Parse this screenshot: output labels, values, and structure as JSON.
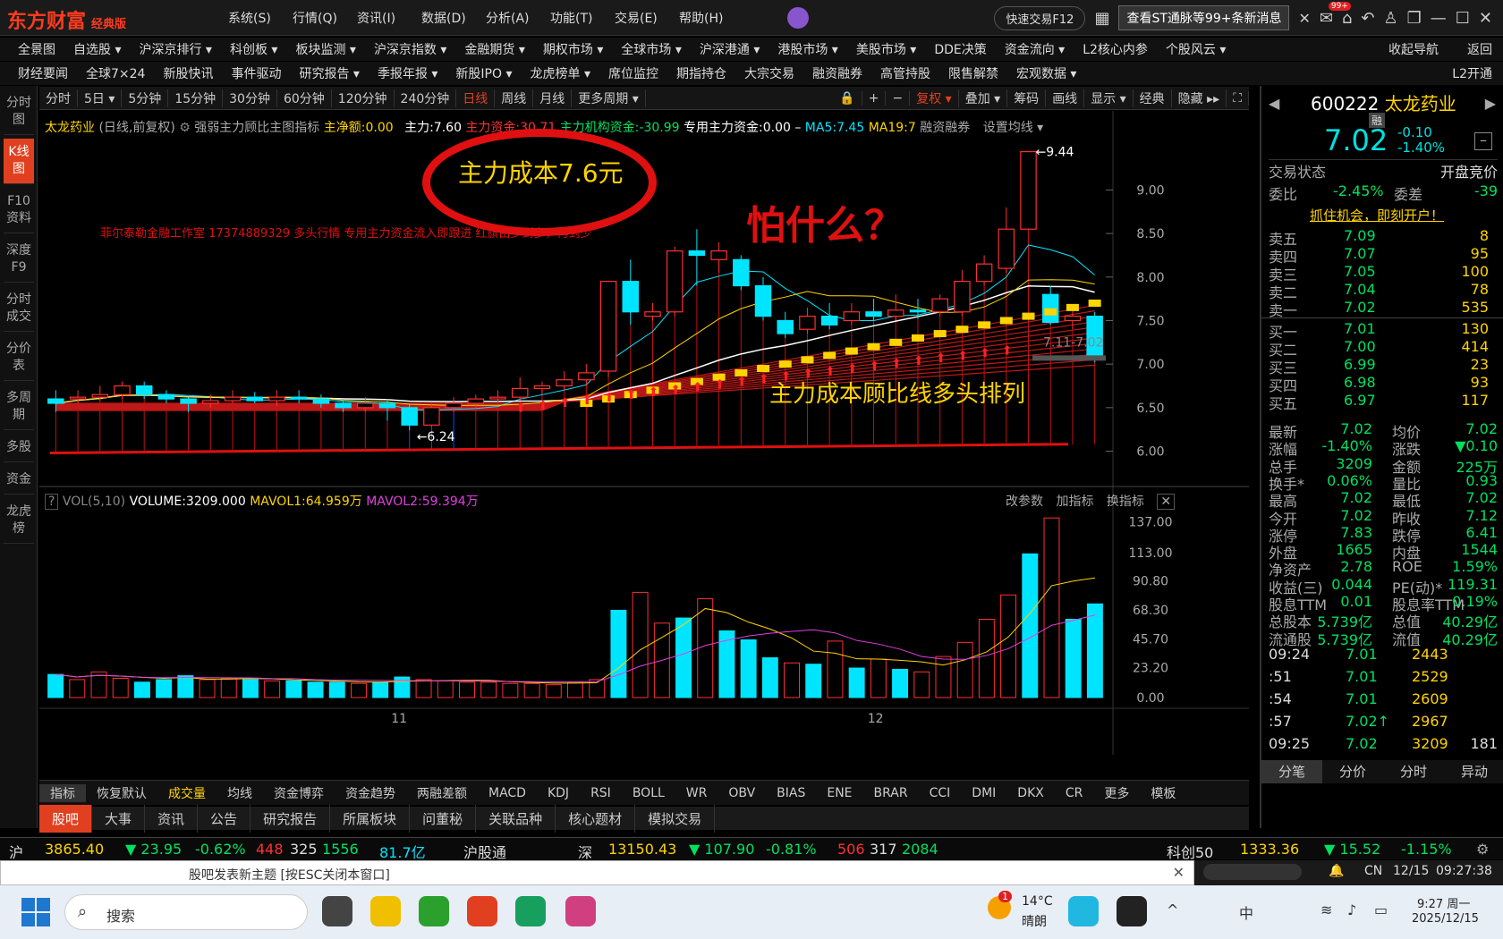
{
  "titlebar": {
    "logo": "东方财富",
    "edition": "经典版",
    "menus": [
      "系统(S)",
      "行情(Q)",
      "资讯(I)",
      "数据(D)",
      "分析(A)",
      "功能(T)",
      "交易(E)",
      "帮助(H)"
    ],
    "quick_trade": "快速交易F12",
    "notice": "查看ST通脉等99+条新消息",
    "badge": "99+"
  },
  "nav1": [
    "全景图",
    "自选股 ▾",
    "沪深京排行 ▾",
    "科创板 ▾",
    "板块监测 ▾",
    "沪深京指数 ▾",
    "金融期货 ▾",
    "期权市场 ▾",
    "全球市场 ▾",
    "沪深港通 ▾",
    "港股市场 ▾",
    "美股市场 ▾",
    "DDE决策",
    "资金流向 ▾",
    "L2核心内参",
    "个股风云 ▾"
  ],
  "nav1_right": [
    "收起导航",
    "返回"
  ],
  "nav2": [
    "财经要闻",
    "全球7×24",
    "新股快讯",
    "事件驱动",
    "研究报告 ▾",
    "季报年报 ▾",
    "新股IPO ▾",
    "龙虎榜单 ▾",
    "席位监控",
    "期指持仓",
    "大宗交易",
    "融资融券",
    "高管持股",
    "限售解禁",
    "宏观数据 ▾"
  ],
  "nav2_right": "L2开通",
  "sidebar": [
    "分时图",
    "K线图",
    "F10资料",
    "深度F9",
    "分时成交",
    "分价表",
    "多周期",
    "多股",
    "资金",
    "龙虎榜"
  ],
  "toolbar": [
    "分时",
    "5日 ▾",
    "5分钟",
    "15分钟",
    "30分钟",
    "60分钟",
    "120分钟",
    "240分钟",
    "日线",
    "周线",
    "月线",
    "更多周期 ▾"
  ],
  "toolbar_right": [
    "复权 ▾",
    "叠加 ▾",
    "筹码",
    "画线",
    "显示 ▾",
    "经典",
    "隐藏 ▸▸"
  ],
  "chart_header": {
    "name": "太龙药业",
    "mode": "(日线,前复权)",
    "indicator": "强弱主力顾比主图指标",
    "net": "主净额:0.00",
    "main": "主力:7.60",
    "fund": "主力资金:30.71",
    "inst": "主力机构资金:-30.99",
    "special": "专用主力资金:0.00 –",
    "ma5": "MA5:7.45",
    "ma19": "MA19:7",
    "margin": "融资融券",
    "set_ma": "设置均线 ▾"
  },
  "annotations": {
    "circle_text": "主力成本7.6元",
    "question": "怕什么？",
    "studio": "菲尔泰勒金融工作室 17374889329 多头行情 专用主力资金流入即跟进 红旗由少到多，再到少",
    "bottom_note": "主力成本顾比线多头排列",
    "high_label": "9.44",
    "low_label": "6.24",
    "range_label": "7.11-7.02"
  },
  "chart_data": {
    "type": "candlestick",
    "price_axis": [
      "9.00",
      "8.50",
      "8.00",
      "7.50",
      "7.00",
      "6.50",
      "6.00"
    ],
    "ylim": [
      5.8,
      9.6
    ],
    "x_ticks": [
      "11",
      "12"
    ],
    "candles": [
      [
        6.6,
        6.55,
        6.7,
        6.45
      ],
      [
        6.6,
        6.62,
        6.7,
        6.55
      ],
      [
        6.62,
        6.65,
        6.75,
        6.58
      ],
      [
        6.65,
        6.75,
        6.8,
        6.6
      ],
      [
        6.75,
        6.65,
        6.8,
        6.6
      ],
      [
        6.65,
        6.6,
        6.7,
        6.55
      ],
      [
        6.6,
        6.55,
        6.62,
        6.45
      ],
      [
        6.55,
        6.58,
        6.65,
        6.5
      ],
      [
        6.58,
        6.62,
        6.7,
        6.55
      ],
      [
        6.62,
        6.58,
        6.68,
        6.55
      ],
      [
        6.58,
        6.62,
        6.7,
        6.52
      ],
      [
        6.62,
        6.6,
        6.7,
        6.55
      ],
      [
        6.6,
        6.55,
        6.65,
        6.5
      ],
      [
        6.55,
        6.5,
        6.6,
        6.45
      ],
      [
        6.5,
        6.55,
        6.62,
        6.45
      ],
      [
        6.55,
        6.5,
        6.6,
        6.35
      ],
      [
        6.5,
        6.3,
        6.55,
        6.24
      ],
      [
        6.3,
        6.5,
        6.55,
        6.28
      ],
      [
        6.5,
        6.55,
        6.62,
        6.45
      ],
      [
        6.55,
        6.6,
        6.65,
        6.5
      ],
      [
        6.6,
        6.62,
        6.7,
        6.55
      ],
      [
        6.62,
        6.72,
        6.85,
        6.58
      ],
      [
        6.72,
        6.75,
        6.8,
        6.65
      ],
      [
        6.75,
        6.82,
        6.92,
        6.7
      ],
      [
        6.82,
        6.9,
        7.0,
        6.75
      ],
      [
        6.92,
        7.95,
        7.95,
        6.85
      ],
      [
        7.95,
        7.6,
        8.2,
        7.45
      ],
      [
        7.55,
        7.6,
        7.7,
        7.5
      ],
      [
        7.6,
        8.3,
        8.35,
        7.55
      ],
      [
        8.3,
        8.25,
        8.55,
        7.9
      ],
      [
        8.2,
        8.3,
        8.4,
        8.05
      ],
      [
        8.2,
        7.9,
        8.25,
        7.85
      ],
      [
        7.9,
        7.55,
        8.0,
        7.5
      ],
      [
        7.5,
        7.35,
        7.6,
        7.3
      ],
      [
        7.4,
        7.55,
        7.65,
        7.35
      ],
      [
        7.55,
        7.45,
        7.7,
        7.4
      ],
      [
        7.5,
        7.6,
        7.7,
        7.45
      ],
      [
        7.6,
        7.55,
        7.75,
        7.5
      ],
      [
        7.55,
        7.62,
        7.8,
        7.5
      ],
      [
        7.62,
        7.6,
        7.75,
        7.52
      ],
      [
        7.6,
        7.75,
        7.8,
        7.55
      ],
      [
        7.6,
        7.95,
        8.08,
        7.55
      ],
      [
        7.95,
        8.15,
        8.25,
        7.9
      ],
      [
        8.1,
        8.55,
        8.8,
        8.05
      ],
      [
        8.55,
        9.44,
        9.44,
        8.55
      ],
      [
        7.8,
        7.48,
        7.9,
        7.45
      ],
      [
        7.5,
        7.55,
        7.65,
        7.4
      ],
      [
        7.55,
        7.1,
        7.6,
        7.02
      ]
    ],
    "volume_axis": [
      "137.00",
      "113.00",
      "90.80",
      "68.30",
      "45.70",
      "23.20",
      "0.00"
    ],
    "volume_max": 145,
    "volumes": [
      18,
      14,
      20,
      15,
      12,
      14,
      17,
      14,
      15,
      14,
      13,
      13,
      12,
      12,
      11,
      12,
      16,
      14,
      13,
      12,
      12,
      11,
      11,
      10,
      12,
      14,
      68,
      82,
      58,
      62,
      77,
      52,
      45,
      31,
      27,
      26,
      44,
      23,
      30,
      22,
      20,
      32,
      43,
      61,
      80,
      112,
      140,
      61,
      73
    ],
    "volume_header": {
      "label": "VOL(5,10)",
      "volume": "VOLUME:3209.000",
      "mavol1": "MAVOL1:64.959万",
      "mavol2": "MAVOL2:59.394万"
    },
    "volume_right": [
      "改参数",
      "加指标",
      "换指标"
    ]
  },
  "indicator_tabs": [
    "指标",
    "恢复默认",
    "成交量",
    "均线",
    "资金博弈",
    "资金趋势",
    "两融差额",
    "MACD",
    "KDJ",
    "RSI",
    "BOLL",
    "WR",
    "OBV",
    "BIAS",
    "ENE",
    "BRAR",
    "CCI",
    "DMI",
    "DKX",
    "CR",
    "更多",
    "模板"
  ],
  "bottom_tabs": [
    "股吧",
    "大事",
    "资讯",
    "公告",
    "研究报告",
    "所属板块",
    "问董秘",
    "关联品种",
    "核心题材",
    "模拟交易"
  ],
  "quote": {
    "code": "600222",
    "name": "太龙药业",
    "price": "7.02",
    "change": "-0.10",
    "pct": "-1.40%",
    "margin_tag": "融",
    "state_label": "交易状态",
    "state_value": "开盘竞价",
    "wei_bi": [
      "委比",
      "-2.45%",
      "委差",
      "-39"
    ],
    "ad": "抓住机会，即刻开户！",
    "sell": [
      [
        "卖五",
        "7.09",
        "8"
      ],
      [
        "卖四",
        "7.07",
        "95"
      ],
      [
        "卖三",
        "7.05",
        "100"
      ],
      [
        "卖二",
        "7.04",
        "78"
      ],
      [
        "卖一",
        "7.02",
        "535"
      ]
    ],
    "buy": [
      [
        "买一",
        "7.01",
        "130"
      ],
      [
        "买二",
        "7.00",
        "414"
      ],
      [
        "买三",
        "6.99",
        "23"
      ],
      [
        "买四",
        "6.98",
        "93"
      ],
      [
        "买五",
        "6.97",
        "117"
      ]
    ],
    "stats": [
      [
        "最新",
        "7.02",
        "均价",
        "7.02"
      ],
      [
        "涨幅",
        "-1.40%",
        "涨跌",
        "▼0.10"
      ],
      [
        "总手",
        "3209",
        "金额",
        "225万"
      ],
      [
        "换手*",
        "0.06%",
        "量比",
        "0.93"
      ],
      [
        "最高",
        "7.02",
        "最低",
        "7.02"
      ],
      [
        "今开",
        "7.02",
        "昨收",
        "7.12"
      ],
      [
        "涨停",
        "7.83",
        "跌停",
        "6.41"
      ],
      [
        "外盘",
        "1665",
        "内盘",
        "1544"
      ],
      [
        "净资产",
        "2.78",
        "ROE",
        "1.59%"
      ],
      [
        "收益(三)",
        "0.044",
        "PE(动)*",
        "119.31"
      ],
      [
        "股息TTM",
        "0.01",
        "股息率TTM",
        "0.19%"
      ],
      [
        "总股本",
        "5.739亿",
        "总值",
        "40.29亿"
      ],
      [
        "流通股",
        "5.739亿",
        "流值",
        "40.29亿"
      ]
    ],
    "ticks": [
      [
        "09:24",
        "7.01",
        "2443",
        ""
      ],
      [
        ":51",
        "7.01",
        "2529",
        ""
      ],
      [
        ":54",
        "7.01",
        "2609",
        ""
      ],
      [
        ":57",
        "7.02↑",
        "2967",
        ""
      ],
      [
        "09:25",
        "7.02",
        "3209",
        "181"
      ]
    ],
    "tabs": [
      "分笔",
      "分价",
      "分时",
      "异动"
    ]
  },
  "statusbar": {
    "sh": "沪",
    "sh_index": "3865.40",
    "sh_chg": "▼ 23.95",
    "sh_pct": "-0.62%",
    "sh_up": "448",
    "sh_flat": "325",
    "sh_down": "1556",
    "sh_amt": "81.7亿",
    "hgt": "沪股通",
    "sz": "深",
    "sz_index": "13150.43",
    "sz_chg": "▼ 107.90",
    "sz_pct": "-0.81%",
    "sz_up": "506",
    "sz_flat": "317",
    "sz_down": "2084",
    "kc": "科创50",
    "kc_index": "1333.36",
    "kc_chg": "▼ 15.52",
    "kc_pct": "-1.15%"
  },
  "popup": {
    "text": "股吧发表新主题 [按ESC关闭本窗口]",
    "net": "CN",
    "date": "12/15",
    "time": "09:27:38"
  },
  "taskbar": {
    "search": "搜索",
    "weather_temp": "14°C",
    "weather": "晴朗",
    "weather_badge": "1",
    "clock": "9:27 周一",
    "date": "2025/12/15",
    "ime": "中"
  },
  "colors": {
    "up": "#ff3030",
    "down": "#00e5ff",
    "yellow": "#ffd400",
    "accent": "#e04020"
  }
}
